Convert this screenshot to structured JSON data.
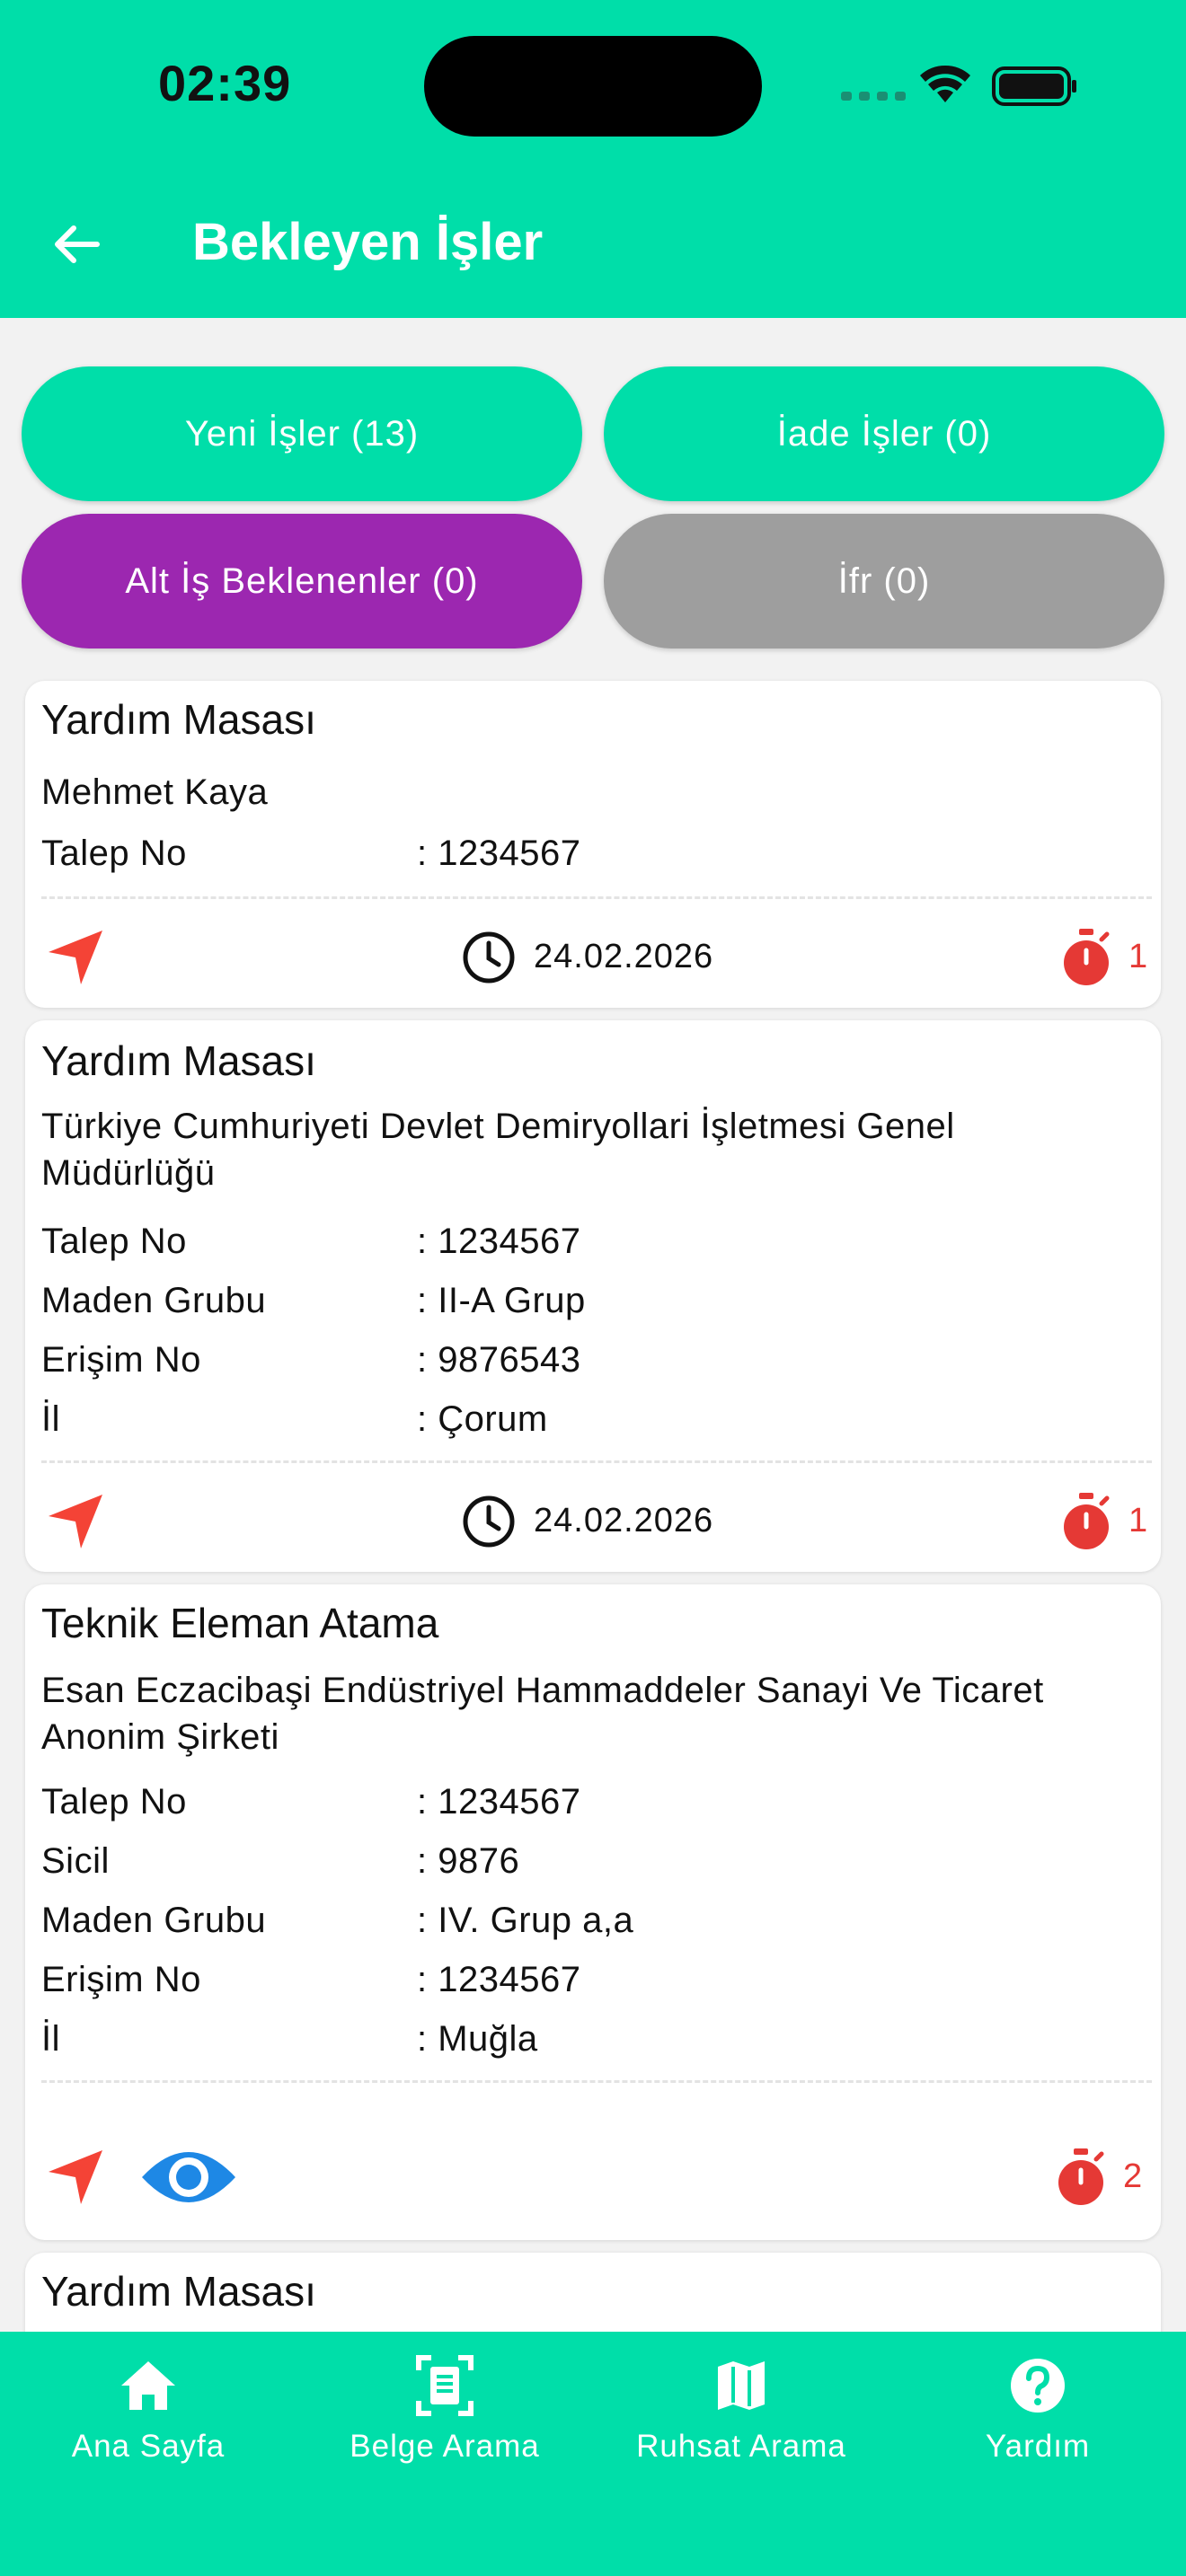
{
  "status_bar": {
    "time": "02:39"
  },
  "header": {
    "title": "Bekleyen İşler"
  },
  "filters": [
    {
      "label": "Yeni İşler (13)",
      "color": "#00dea9"
    },
    {
      "label": "İade İşler (0)",
      "color": "#00dea9"
    },
    {
      "label": "Alt İş Beklenenler (0)",
      "color": "#9c27b0"
    },
    {
      "label": "İfr (0)",
      "color": "#9e9e9e"
    }
  ],
  "cards": [
    {
      "type": "Yardım Masası",
      "company": "Mehmet Kaya",
      "fields": [
        {
          "label": "Talep No",
          "value": ": 1234567"
        }
      ],
      "date": "24.02.2026",
      "count": "1",
      "icons": [
        "navigation-icon",
        "clock-icon",
        "stopwatch-icon"
      ]
    },
    {
      "type": "Yardım Masası",
      "company": "Türkiye Cumhuriyeti Devlet Demiryollari İşletmesi Genel Müdürlüğü",
      "fields": [
        {
          "label": "Talep No",
          "value": ": 1234567"
        },
        {
          "label": "Maden Grubu",
          "value": ": II-A Grup"
        },
        {
          "label": "Erişim No",
          "value": ": 9876543"
        },
        {
          "label": "İl",
          "value": ": Çorum"
        }
      ],
      "date": "24.02.2026",
      "count": "1",
      "icons": [
        "navigation-icon",
        "clock-icon",
        "stopwatch-icon"
      ]
    },
    {
      "type": "Teknik Eleman Atama",
      "company": "Esan Eczacibaşi Endüstriyel Hammaddeler Sanayi Ve Ticaret Anonim Şirketi",
      "fields": [
        {
          "label": "Talep No",
          "value": ": 1234567"
        },
        {
          "label": "Sicil",
          "value": ": 9876"
        },
        {
          "label": "Maden Grubu",
          "value": ": IV. Grup a,a"
        },
        {
          "label": "Erişim No",
          "value": ": 1234567"
        },
        {
          "label": "İl",
          "value": ": Muğla"
        }
      ],
      "count": "2",
      "icons": [
        "navigation-icon",
        "eye-icon",
        "stopwatch-icon"
      ]
    },
    {
      "type": "Yardım Masası"
    }
  ],
  "bottom_nav": [
    {
      "label": "Ana Sayfa",
      "icon": "home-icon"
    },
    {
      "label": "Belge Arama",
      "icon": "document-scan-icon"
    },
    {
      "label": "Ruhsat Arama",
      "icon": "map-icon"
    },
    {
      "label": "Yardım",
      "icon": "help-icon"
    }
  ],
  "colors": {
    "accent": "#00dea9",
    "purple": "#9c27b0",
    "gray": "#9e9e9e",
    "alert_red": "#e53935",
    "eye_blue": "#1e88e5"
  }
}
